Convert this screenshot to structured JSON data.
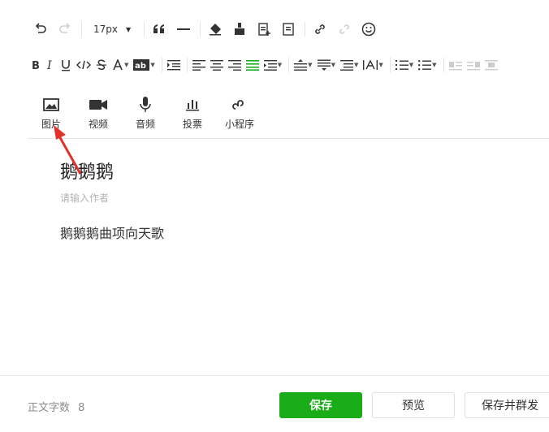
{
  "toolbar": {
    "font_size": "17px"
  },
  "media": [
    {
      "label": "图片",
      "icon": "image-icon"
    },
    {
      "label": "视频",
      "icon": "video-icon"
    },
    {
      "label": "音频",
      "icon": "microphone-icon"
    },
    {
      "label": "投票",
      "icon": "vote-icon"
    },
    {
      "label": "小程序",
      "icon": "mini-program-icon"
    }
  ],
  "article": {
    "title": "鹅鹅鹅",
    "author_placeholder": "请输入作者",
    "body": "鹅鹅鹅曲项向天歌"
  },
  "footer": {
    "word_count_label": "正文字数",
    "word_count": "8",
    "save_label": "保存",
    "preview_label": "预览",
    "save_send_label": "保存并群发"
  },
  "colors": {
    "primary": "#1aad19",
    "arrow": "#e2302b"
  }
}
